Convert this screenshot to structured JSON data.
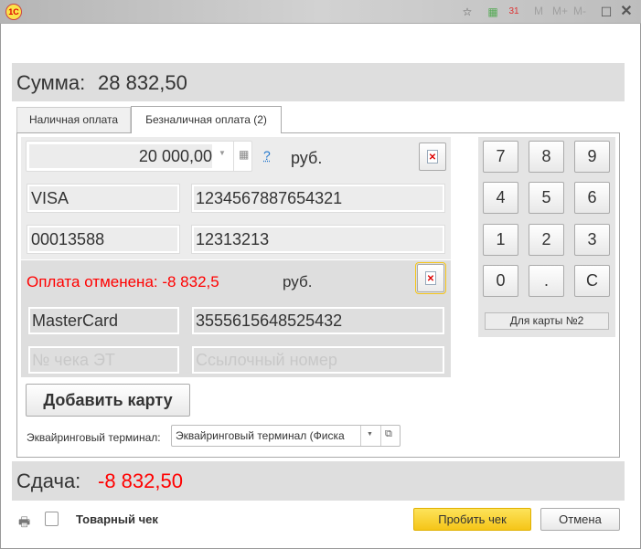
{
  "window": {
    "logo": "1С",
    "toolbar": [
      "favorites-icon",
      "calculator-icon",
      "calendar-icon"
    ],
    "calendar_day": "31",
    "memory": [
      "M",
      "M+",
      "M-"
    ]
  },
  "sum": {
    "label": "Сумма:",
    "value": "28 832,50"
  },
  "tabs": [
    {
      "label": "Наличная оплата"
    },
    {
      "label": "Безналичная оплата (2)"
    }
  ],
  "card1": {
    "amount": "20 000,00",
    "help": "?",
    "currency": "руб.",
    "type": "VISA",
    "number": "1234567887654321",
    "check": "00013588",
    "ref": "12313213"
  },
  "card2": {
    "status": "Оплата отменена: -8 832,5",
    "currency": "руб.",
    "type": "MasterCard",
    "number": "3555615648525432",
    "check_placeholder": "№ чека ЭТ",
    "ref_placeholder": "Ссылочный номер"
  },
  "keypad": {
    "keys": [
      "7",
      "8",
      "9",
      "4",
      "5",
      "6",
      "1",
      "2",
      "3",
      "0",
      ".",
      "C"
    ],
    "target": "Для карты №2"
  },
  "add_card": "Добавить карту",
  "terminal": {
    "label": "Эквайринговый терминал:",
    "value": "Эквайринговый терминал  (Фиска"
  },
  "change": {
    "label": "Сдача:",
    "value": "-8 832,50"
  },
  "footer": {
    "receipt_label": "Товарный чек",
    "receipt_checked": false,
    "submit": "Пробить чек",
    "cancel": "Отмена"
  },
  "colors": {
    "negative": "#ff0000",
    "accent": "#f5c518"
  }
}
